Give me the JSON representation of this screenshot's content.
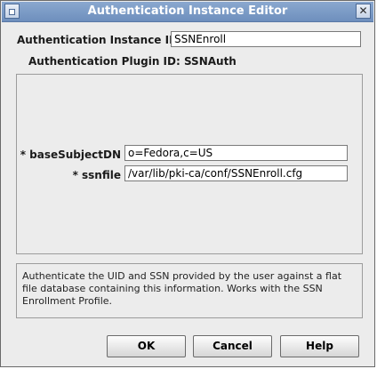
{
  "window": {
    "title": "Authentication Instance Editor",
    "close_glyph": "✕"
  },
  "form": {
    "instance_id_label": "Authentication Instance ID:",
    "instance_id_value": "SSNEnroll",
    "plugin_id_label": "Authentication Plugin ID:",
    "plugin_id_value": "SSNAuth",
    "params": [
      {
        "label": "* baseSubjectDN",
        "value": "o=Fedora,c=US"
      },
      {
        "label": "* ssnfile",
        "value": "/var/lib/pki-ca/conf/SSNEnroll.cfg"
      }
    ]
  },
  "description": "Authenticate the UID and SSN provided by the user against a flat file database containing this information.  Works with the SSN Enrollment Profile.",
  "buttons": {
    "ok": "OK",
    "cancel": "Cancel",
    "help": "Help"
  },
  "icons": {
    "window_menu": "window-menu-icon",
    "close": "close-icon"
  }
}
